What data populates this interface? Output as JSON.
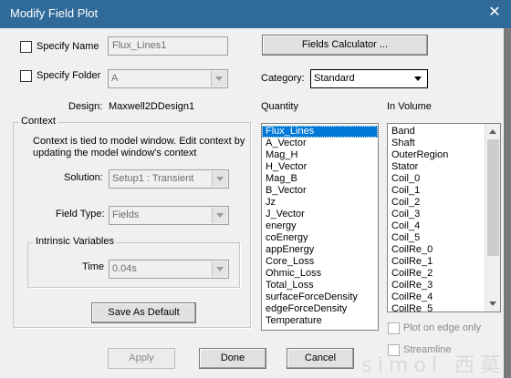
{
  "window": {
    "title": "Modify Field Plot"
  },
  "specify_name": {
    "label": "Specify Name",
    "value": "Flux_Lines1",
    "checked": false
  },
  "specify_folder": {
    "label": "Specify Folder",
    "value": "A",
    "checked": false
  },
  "design": {
    "label": "Design:",
    "value": "Maxwell2DDesign1"
  },
  "context": {
    "title": "Context",
    "description": "Context is tied to model window. Edit context by updating the model window's context",
    "solution_label": "Solution:",
    "solution_value": "Setup1 : Transient",
    "field_type_label": "Field Type:",
    "field_type_value": "Fields",
    "intrinsic": {
      "title": "Intrinsic Variables",
      "time_label": "Time",
      "time_value": "0.04s"
    },
    "save_default": "Save As Default"
  },
  "fields_calculator": "Fields Calculator ...",
  "category": {
    "label": "Category:",
    "value": "Standard"
  },
  "quantity": {
    "label": "Quantity",
    "items": [
      "Flux_Lines",
      "A_Vector",
      "Mag_H",
      "H_Vector",
      "Mag_B",
      "B_Vector",
      "Jz",
      "J_Vector",
      "energy",
      "coEnergy",
      "appEnergy",
      "Core_Loss",
      "Ohmic_Loss",
      "Total_Loss",
      "surfaceForceDensity",
      "edgeForceDensity",
      "Temperature"
    ],
    "selected": "Flux_Lines"
  },
  "in_volume": {
    "label": "In Volume",
    "items": [
      "Band",
      "Shaft",
      "OuterRegion",
      "Stator",
      "Coil_0",
      "Coil_1",
      "Coil_2",
      "Coil_3",
      "Coil_4",
      "Coil_5",
      "CoilRe_0",
      "CoilRe_1",
      "CoilRe_2",
      "CoilRe_3",
      "CoilRe_4",
      "CoilRe_5"
    ]
  },
  "plot_on_edge": {
    "label": "Plot on edge only",
    "checked": false
  },
  "streamline": {
    "label": "Streamline",
    "checked": false
  },
  "buttons": {
    "apply": "Apply",
    "done": "Done",
    "cancel": "Cancel"
  },
  "watermark": "simol 西莫",
  "colors": {
    "titlebar": "#2f6a99",
    "selection": "#0078d7"
  }
}
